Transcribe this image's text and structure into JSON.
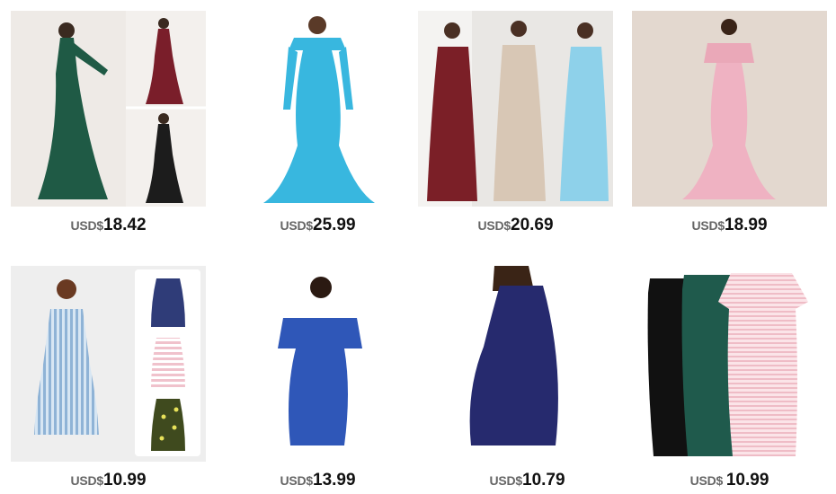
{
  "products": [
    {
      "currency": "USD$",
      "amount": "18.42",
      "image": "green-burgundy-black-maxi-dress"
    },
    {
      "currency": "USD$",
      "amount": "25.99",
      "image": "sky-blue-off-shoulder-maxi-dress"
    },
    {
      "currency": "USD$",
      "amount": "20.69",
      "image": "burgundy-beige-blue-maxi-dresses"
    },
    {
      "currency": "USD$",
      "amount": "18.99",
      "image": "pink-ruffle-maxi-dress"
    },
    {
      "currency": "USD$",
      "amount": "10.99",
      "image": "striped-nursing-sleeveless-dress"
    },
    {
      "currency": "USD$",
      "amount": "13.99",
      "image": "royal-blue-ruffle-midi-dress"
    },
    {
      "currency": "USD$",
      "amount": "10.79",
      "image": "navy-bodycon-tank-dress"
    },
    {
      "currency": "USD$ ",
      "amount": "10.99",
      "image": "black-green-pink-stripe-tshirt-dresses"
    }
  ],
  "colors": {
    "price_text": "#111111",
    "currency_text": "#666666",
    "background": "#ffffff"
  }
}
